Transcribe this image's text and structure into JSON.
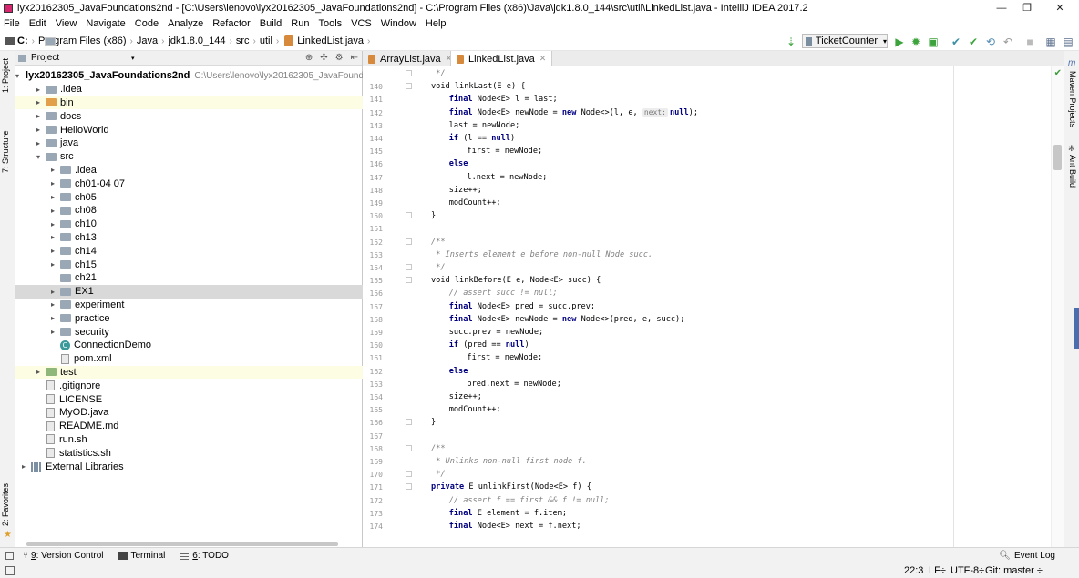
{
  "window": {
    "title": "lyx20162305_JavaFoundations2nd - [C:\\Users\\lenovo\\lyx20162305_JavaFoundations2nd] - C:\\Program Files (x86)\\Java\\jdk1.8.0_144\\src\\util\\LinkedList.java - IntelliJ IDEA 2017.2",
    "minimize": "—",
    "maximize": "❐",
    "close": "✕"
  },
  "menu": [
    "File",
    "Edit",
    "View",
    "Navigate",
    "Code",
    "Analyze",
    "Refactor",
    "Build",
    "Run",
    "Tools",
    "VCS",
    "Window",
    "Help"
  ],
  "breadcrumb": {
    "drive": "C:",
    "items": [
      "Program Files (x86)",
      "Java",
      "jdk1.8.0_144",
      "src",
      "util",
      "LinkedList.java"
    ]
  },
  "toolbar": {
    "run_config": "TicketCounter",
    "icons": [
      "build-arrow-icon",
      "run-icon",
      "debug-icon",
      "coverage-icon",
      "vcs-update-icon",
      "vcs-commit-icon",
      "vcs-history-icon",
      "revert-icon",
      "stop-icon",
      "project-structure-icon",
      "sdk-icon"
    ]
  },
  "left_strip": {
    "project_tab": "1: Project",
    "structure_tab": "7: Structure",
    "favorites_tab": "2: Favorites"
  },
  "right_strip": {
    "maven_tab": "Maven Projects",
    "ant_tab": "Ant Build"
  },
  "project_panel": {
    "header": "Project",
    "root_name": "lyx20162305_JavaFoundations2nd",
    "root_path": "C:\\Users\\lenovo\\lyx20162305_JavaFound",
    "tree": [
      {
        "label": "lyx20162305_JavaFoundations2nd",
        "indent": 0,
        "arrow": "▾",
        "icon": "blue",
        "root": true
      },
      {
        "label": ".idea",
        "indent": 1,
        "arrow": "▸",
        "icon": "gray"
      },
      {
        "label": "bin",
        "indent": 1,
        "arrow": "▸",
        "icon": "orange",
        "hl": true
      },
      {
        "label": "docs",
        "indent": 1,
        "arrow": "▸",
        "icon": "gray"
      },
      {
        "label": "HelloWorld",
        "indent": 1,
        "arrow": "▸",
        "icon": "gray"
      },
      {
        "label": "java",
        "indent": 1,
        "arrow": "▸",
        "icon": "gray"
      },
      {
        "label": "src",
        "indent": 1,
        "arrow": "▾",
        "icon": "gray"
      },
      {
        "label": ".idea",
        "indent": 2,
        "arrow": "▸",
        "icon": "gray"
      },
      {
        "label": "ch01-04 07",
        "indent": 2,
        "arrow": "▸",
        "icon": "gray"
      },
      {
        "label": "ch05",
        "indent": 2,
        "arrow": "▸",
        "icon": "gray"
      },
      {
        "label": "ch08",
        "indent": 2,
        "arrow": "▸",
        "icon": "gray"
      },
      {
        "label": "ch10",
        "indent": 2,
        "arrow": "▸",
        "icon": "gray"
      },
      {
        "label": "ch13",
        "indent": 2,
        "arrow": "▸",
        "icon": "gray"
      },
      {
        "label": "ch14",
        "indent": 2,
        "arrow": "▸",
        "icon": "gray"
      },
      {
        "label": "ch15",
        "indent": 2,
        "arrow": "▸",
        "icon": "gray"
      },
      {
        "label": "ch21",
        "indent": 2,
        "arrow": "",
        "icon": "gray"
      },
      {
        "label": "EX1",
        "indent": 2,
        "arrow": "▸",
        "icon": "gray",
        "sel": true
      },
      {
        "label": "experiment",
        "indent": 2,
        "arrow": "▸",
        "icon": "gray"
      },
      {
        "label": "practice",
        "indent": 2,
        "arrow": "▸",
        "icon": "gray"
      },
      {
        "label": "security",
        "indent": 2,
        "arrow": "▸",
        "icon": "gray"
      },
      {
        "label": "ConnectionDemo",
        "indent": 2,
        "arrow": "",
        "icon": "class"
      },
      {
        "label": "pom.xml",
        "indent": 2,
        "arrow": "",
        "icon": "file"
      },
      {
        "label": "test",
        "indent": 1,
        "arrow": "▸",
        "icon": "green",
        "hl": true
      },
      {
        "label": ".gitignore",
        "indent": 1,
        "arrow": "",
        "icon": "file"
      },
      {
        "label": "LICENSE",
        "indent": 1,
        "arrow": "",
        "icon": "file"
      },
      {
        "label": "MyOD.java",
        "indent": 1,
        "arrow": "",
        "icon": "file"
      },
      {
        "label": "README.md",
        "indent": 1,
        "arrow": "",
        "icon": "file"
      },
      {
        "label": "run.sh",
        "indent": 1,
        "arrow": "",
        "icon": "file"
      },
      {
        "label": "statistics.sh",
        "indent": 1,
        "arrow": "",
        "icon": "file"
      },
      {
        "label": "External Libraries",
        "indent": 0,
        "arrow": "▸",
        "icon": "lib"
      }
    ]
  },
  "editor": {
    "tabs": [
      {
        "label": "ArrayList.java",
        "active": false
      },
      {
        "label": "LinkedList.java",
        "active": true
      }
    ],
    "lines": [
      {
        "n": "",
        "indent": 1,
        "parts": [
          {
            "t": " */",
            "c": "cm"
          }
        ]
      },
      {
        "n": "140",
        "indent": 1,
        "parts": [
          {
            "t": "void linkLast(E e) {",
            "c": ""
          }
        ]
      },
      {
        "n": "141",
        "indent": 2,
        "parts": [
          {
            "t": "final",
            "c": "kw"
          },
          {
            "t": " Node<E> l = last;",
            "c": ""
          }
        ]
      },
      {
        "n": "142",
        "indent": 2,
        "parts": [
          {
            "t": "final",
            "c": "kw"
          },
          {
            "t": " Node<E> newNode = ",
            "c": ""
          },
          {
            "t": "new",
            "c": "kw"
          },
          {
            "t": " Node<>(l, e, ",
            "c": ""
          },
          {
            "t": "next:",
            "c": "hint"
          },
          {
            "t": "null",
            "c": "kw"
          },
          {
            "t": ");",
            "c": ""
          }
        ]
      },
      {
        "n": "143",
        "indent": 2,
        "parts": [
          {
            "t": "last = newNode;",
            "c": ""
          }
        ]
      },
      {
        "n": "144",
        "indent": 2,
        "parts": [
          {
            "t": "if",
            "c": "kw"
          },
          {
            "t": " (l == ",
            "c": ""
          },
          {
            "t": "null",
            "c": "kw"
          },
          {
            "t": ")",
            "c": ""
          }
        ]
      },
      {
        "n": "145",
        "indent": 3,
        "parts": [
          {
            "t": "first = newNode;",
            "c": ""
          }
        ]
      },
      {
        "n": "146",
        "indent": 2,
        "parts": [
          {
            "t": "else",
            "c": "kw"
          }
        ]
      },
      {
        "n": "147",
        "indent": 3,
        "parts": [
          {
            "t": "l.next = newNode;",
            "c": ""
          }
        ]
      },
      {
        "n": "148",
        "indent": 2,
        "parts": [
          {
            "t": "size++;",
            "c": ""
          }
        ]
      },
      {
        "n": "149",
        "indent": 2,
        "parts": [
          {
            "t": "modCount++;",
            "c": ""
          }
        ]
      },
      {
        "n": "150",
        "indent": 1,
        "parts": [
          {
            "t": "}",
            "c": ""
          }
        ]
      },
      {
        "n": "151",
        "indent": 1,
        "parts": []
      },
      {
        "n": "152",
        "indent": 1,
        "parts": [
          {
            "t": "/**",
            "c": "cm"
          }
        ]
      },
      {
        "n": "153",
        "indent": 1,
        "parts": [
          {
            "t": " * Inserts element e before non-null Node succ.",
            "c": "cm"
          }
        ]
      },
      {
        "n": "154",
        "indent": 1,
        "parts": [
          {
            "t": " */",
            "c": "cm"
          }
        ]
      },
      {
        "n": "155",
        "indent": 1,
        "parts": [
          {
            "t": "void linkBefore(E e, Node<E> succ) {",
            "c": ""
          }
        ]
      },
      {
        "n": "156",
        "indent": 2,
        "parts": [
          {
            "t": "// assert succ != null;",
            "c": "cm"
          }
        ]
      },
      {
        "n": "157",
        "indent": 2,
        "parts": [
          {
            "t": "final",
            "c": "kw"
          },
          {
            "t": " Node<E> pred = succ.prev;",
            "c": ""
          }
        ]
      },
      {
        "n": "158",
        "indent": 2,
        "parts": [
          {
            "t": "final",
            "c": "kw"
          },
          {
            "t": " Node<E> newNode = ",
            "c": ""
          },
          {
            "t": "new",
            "c": "kw"
          },
          {
            "t": " Node<>(pred, e, succ);",
            "c": ""
          }
        ]
      },
      {
        "n": "159",
        "indent": 2,
        "parts": [
          {
            "t": "succ.prev = newNode;",
            "c": ""
          }
        ]
      },
      {
        "n": "160",
        "indent": 2,
        "parts": [
          {
            "t": "if",
            "c": "kw"
          },
          {
            "t": " (pred == ",
            "c": ""
          },
          {
            "t": "null",
            "c": "kw"
          },
          {
            "t": ")",
            "c": ""
          }
        ]
      },
      {
        "n": "161",
        "indent": 3,
        "parts": [
          {
            "t": "first = newNode;",
            "c": ""
          }
        ]
      },
      {
        "n": "162",
        "indent": 2,
        "parts": [
          {
            "t": "else",
            "c": "kw"
          }
        ]
      },
      {
        "n": "163",
        "indent": 3,
        "parts": [
          {
            "t": "pred.next = newNode;",
            "c": ""
          }
        ]
      },
      {
        "n": "164",
        "indent": 2,
        "parts": [
          {
            "t": "size++;",
            "c": ""
          }
        ]
      },
      {
        "n": "165",
        "indent": 2,
        "parts": [
          {
            "t": "modCount++;",
            "c": ""
          }
        ]
      },
      {
        "n": "166",
        "indent": 1,
        "parts": [
          {
            "t": "}",
            "c": ""
          }
        ]
      },
      {
        "n": "167",
        "indent": 1,
        "parts": []
      },
      {
        "n": "168",
        "indent": 1,
        "parts": [
          {
            "t": "/**",
            "c": "cm"
          }
        ]
      },
      {
        "n": "169",
        "indent": 1,
        "parts": [
          {
            "t": " * Unlinks non-null first node f.",
            "c": "cm"
          }
        ]
      },
      {
        "n": "170",
        "indent": 1,
        "parts": [
          {
            "t": " */",
            "c": "cm"
          }
        ]
      },
      {
        "n": "171",
        "indent": 1,
        "parts": [
          {
            "t": "private",
            "c": "kw"
          },
          {
            "t": " E unlinkFirst(Node<E> f) {",
            "c": ""
          }
        ]
      },
      {
        "n": "172",
        "indent": 2,
        "parts": [
          {
            "t": "// assert f == first && f != null;",
            "c": "cm"
          }
        ]
      },
      {
        "n": "173",
        "indent": 2,
        "parts": [
          {
            "t": "final",
            "c": "kw"
          },
          {
            "t": " E element = f.item;",
            "c": ""
          }
        ]
      },
      {
        "n": "174",
        "indent": 2,
        "parts": [
          {
            "t": "final",
            "c": "kw"
          },
          {
            "t": " Node<E> next = f.next;",
            "c": ""
          }
        ]
      }
    ]
  },
  "bottom_tabs": [
    {
      "key": "9",
      "label": ": Version Control"
    },
    {
      "key": "",
      "label": "Terminal"
    },
    {
      "key": "6",
      "label": ": TODO"
    }
  ],
  "event_log": "Event Log",
  "status": {
    "position": "22:3",
    "line_sep": "LF÷",
    "encoding": "UTF-8÷",
    "git": "Git: master ÷"
  },
  "colors": {
    "keyword": "#000080",
    "comment": "#808080",
    "selection": "#d9d9d9",
    "run_green": "#3da33d"
  }
}
